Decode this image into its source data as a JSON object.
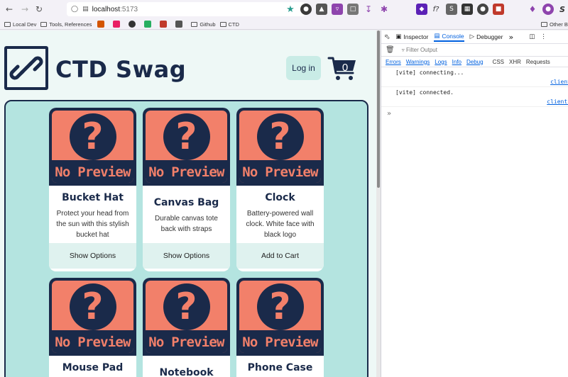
{
  "browser": {
    "url_host": "localhost",
    "url_port": ":5173",
    "bookmarks": [
      "Local Dev",
      "Tools, References",
      "Github",
      "CTD"
    ],
    "other_bookmarks": "Other Boo"
  },
  "site": {
    "title": "CTD Swag",
    "login_label": "Log in",
    "cart_count": "0",
    "placeholder_image_text": "No Preview",
    "placeholder_image_mark": "?"
  },
  "products": [
    {
      "name": "Bucket Hat",
      "description": "Protect your head from the sun with this stylish bucket hat",
      "action": "Show Options"
    },
    {
      "name": "Canvas Bag",
      "description": "Durable canvas tote back with straps",
      "action": "Show Options"
    },
    {
      "name": "Clock",
      "description": "Battery-powered wall clock. White face with black logo",
      "action": "Add to Cart"
    },
    {
      "name": "Mouse Pad",
      "description": "",
      "action": ""
    },
    {
      "name": "Notebook",
      "description": "",
      "action": ""
    },
    {
      "name": "Phone Case",
      "description": "",
      "action": ""
    }
  ],
  "devtools": {
    "tabs": [
      "Inspector",
      "Console",
      "Debugger"
    ],
    "active_tab": "Console",
    "filter_placeholder": "Filter Output",
    "levels": [
      "Errors",
      "Warnings",
      "Logs",
      "Info",
      "Debug"
    ],
    "other_filters": [
      "CSS",
      "XHR",
      "Requests"
    ],
    "logs": [
      {
        "message": "[vite] connecting...",
        "source": "client"
      },
      {
        "message": "[vite] connected.",
        "source": "client:"
      }
    ],
    "prompt": "»"
  },
  "colors": {
    "navy": "#1a2a4a",
    "coral": "#f2806a",
    "mint_panel": "#b4e4e0",
    "page_bg": "#eef8f6"
  }
}
